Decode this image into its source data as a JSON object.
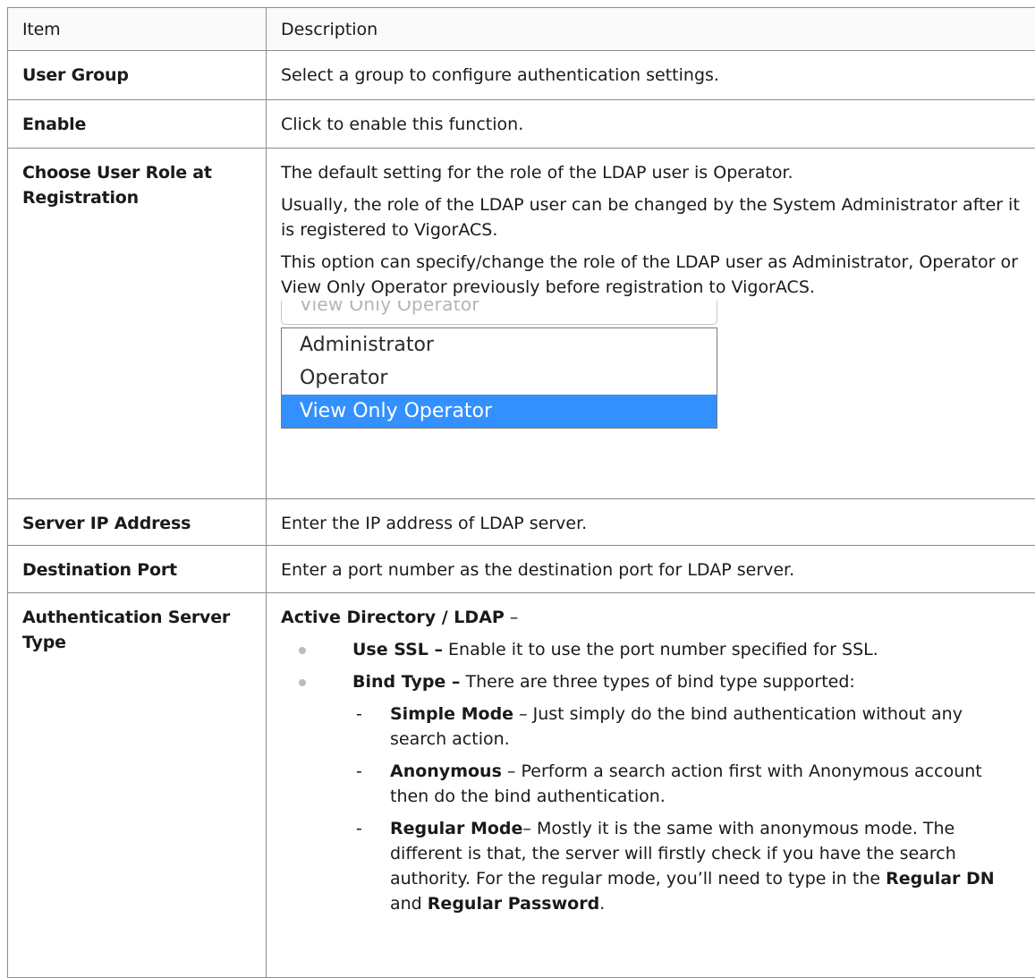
{
  "header": {
    "col_item": "Item",
    "col_desc": "Description"
  },
  "rows": {
    "user_group": {
      "item": "User Group",
      "desc": "Select a group to configure authentication settings."
    },
    "enable": {
      "item": "Enable",
      "desc": "Click to enable this function."
    },
    "role": {
      "item_line1": "Choose User Role at",
      "item_line2": "Registration",
      "p1": "The default setting for the role of the LDAP user is Operator.",
      "p2": "Usually, the role of the LDAP user can be changed by the System Administrator after it is registered to VigorACS.",
      "p3": "This option can specify/change the role of the LDAP user as Administrator, Operator or View Only Operator previously before registration to VigorACS.",
      "dropdown": {
        "current": "View Only Operator",
        "options": [
          "Administrator",
          "Operator",
          "View Only Operator"
        ],
        "selected_color": "#3390ff"
      }
    },
    "server_ip": {
      "item": "Server IP Address",
      "desc": "Enter the IP address of LDAP server."
    },
    "dest_port": {
      "item": "Destination Port",
      "desc": "Enter a port number as the destination port for LDAP server."
    },
    "auth_type": {
      "item_line1": "Authentication Server",
      "item_line2": "Type",
      "heading": "Active Directory / LDAP",
      "heading_suffix": " –",
      "use_ssl_term": "Use SSL –",
      "use_ssl_text": " Enable it to use the port number specified for SSL.",
      "bind_type_term": "Bind Type –",
      "bind_type_text": " There are three types of bind type supported:",
      "bind_modes": [
        {
          "term": "Simple Mode",
          "text": " – Just simply do the bind authentication without any search action."
        },
        {
          "term": "Anonymous",
          "text": " – Perform a search action first with Anonymous account then do the bind authentication."
        }
      ],
      "regular": {
        "term": "Regular Mode",
        "text": "– Mostly it is the same with anonymous mode. The different is that, the server will firstly check if you have the search authority. For the regular mode, you’ll need to type in the ",
        "dn": "Regular DN",
        "and": " and ",
        "pwd": "Regular Password",
        "end": "."
      },
      "dash": "-"
    }
  }
}
